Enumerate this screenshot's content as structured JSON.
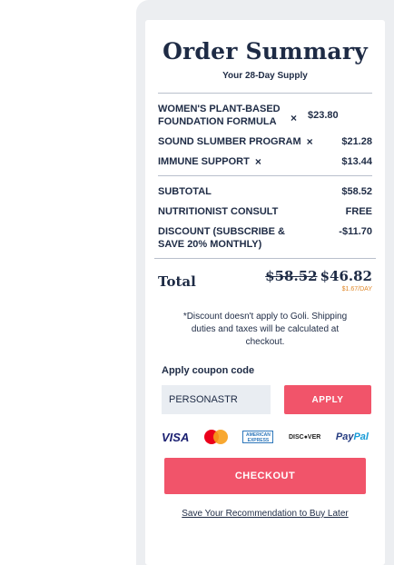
{
  "order": {
    "title": "Order Summary",
    "subtitle": "Your 28-Day Supply",
    "items": [
      {
        "name": "WOMEN'S PLANT-BASED FOUNDATION FORMULA",
        "price": "$23.80"
      },
      {
        "name": "SOUND SLUMBER PROGRAM",
        "price": "$21.28"
      },
      {
        "name": "IMMUNE SUPPORT",
        "price": "$13.44"
      }
    ],
    "remove_glyph": "×",
    "summary": [
      {
        "label": "SUBTOTAL",
        "value": "$58.52"
      },
      {
        "label": "NUTRITIONIST CONSULT",
        "value": "FREE"
      },
      {
        "label": "DISCOUNT (SUBSCRIBE & SAVE 20% MONTHLY)",
        "value": "-$11.70"
      }
    ],
    "total": {
      "label": "Total",
      "old_price": "$58.52",
      "new_price": "$46.82",
      "per_day": "$1.67/DAY"
    },
    "disclaimer": "*Discount doesn't apply to Goli. Shipping duties and taxes will be calculated at checkout.",
    "coupon": {
      "label": "Apply coupon code",
      "value": "PERSONASTR",
      "apply_label": "APPLY"
    },
    "payments": {
      "visa": "VISA",
      "amex": "AMERICAN EXPRESS",
      "discover": "DISC●VER",
      "paypal_a": "Pay",
      "paypal_b": "Pal",
      "icons": [
        "visa-icon",
        "mastercard-icon",
        "amex-icon",
        "discover-icon",
        "paypal-icon"
      ]
    },
    "checkout_label": "CHECKOUT",
    "save_link": "Save Your Recommendation to Buy Later"
  },
  "colors": {
    "accent": "#f1546a",
    "text": "#1e2b45",
    "per_day": "#e0882a",
    "panel": "#eceef1"
  }
}
